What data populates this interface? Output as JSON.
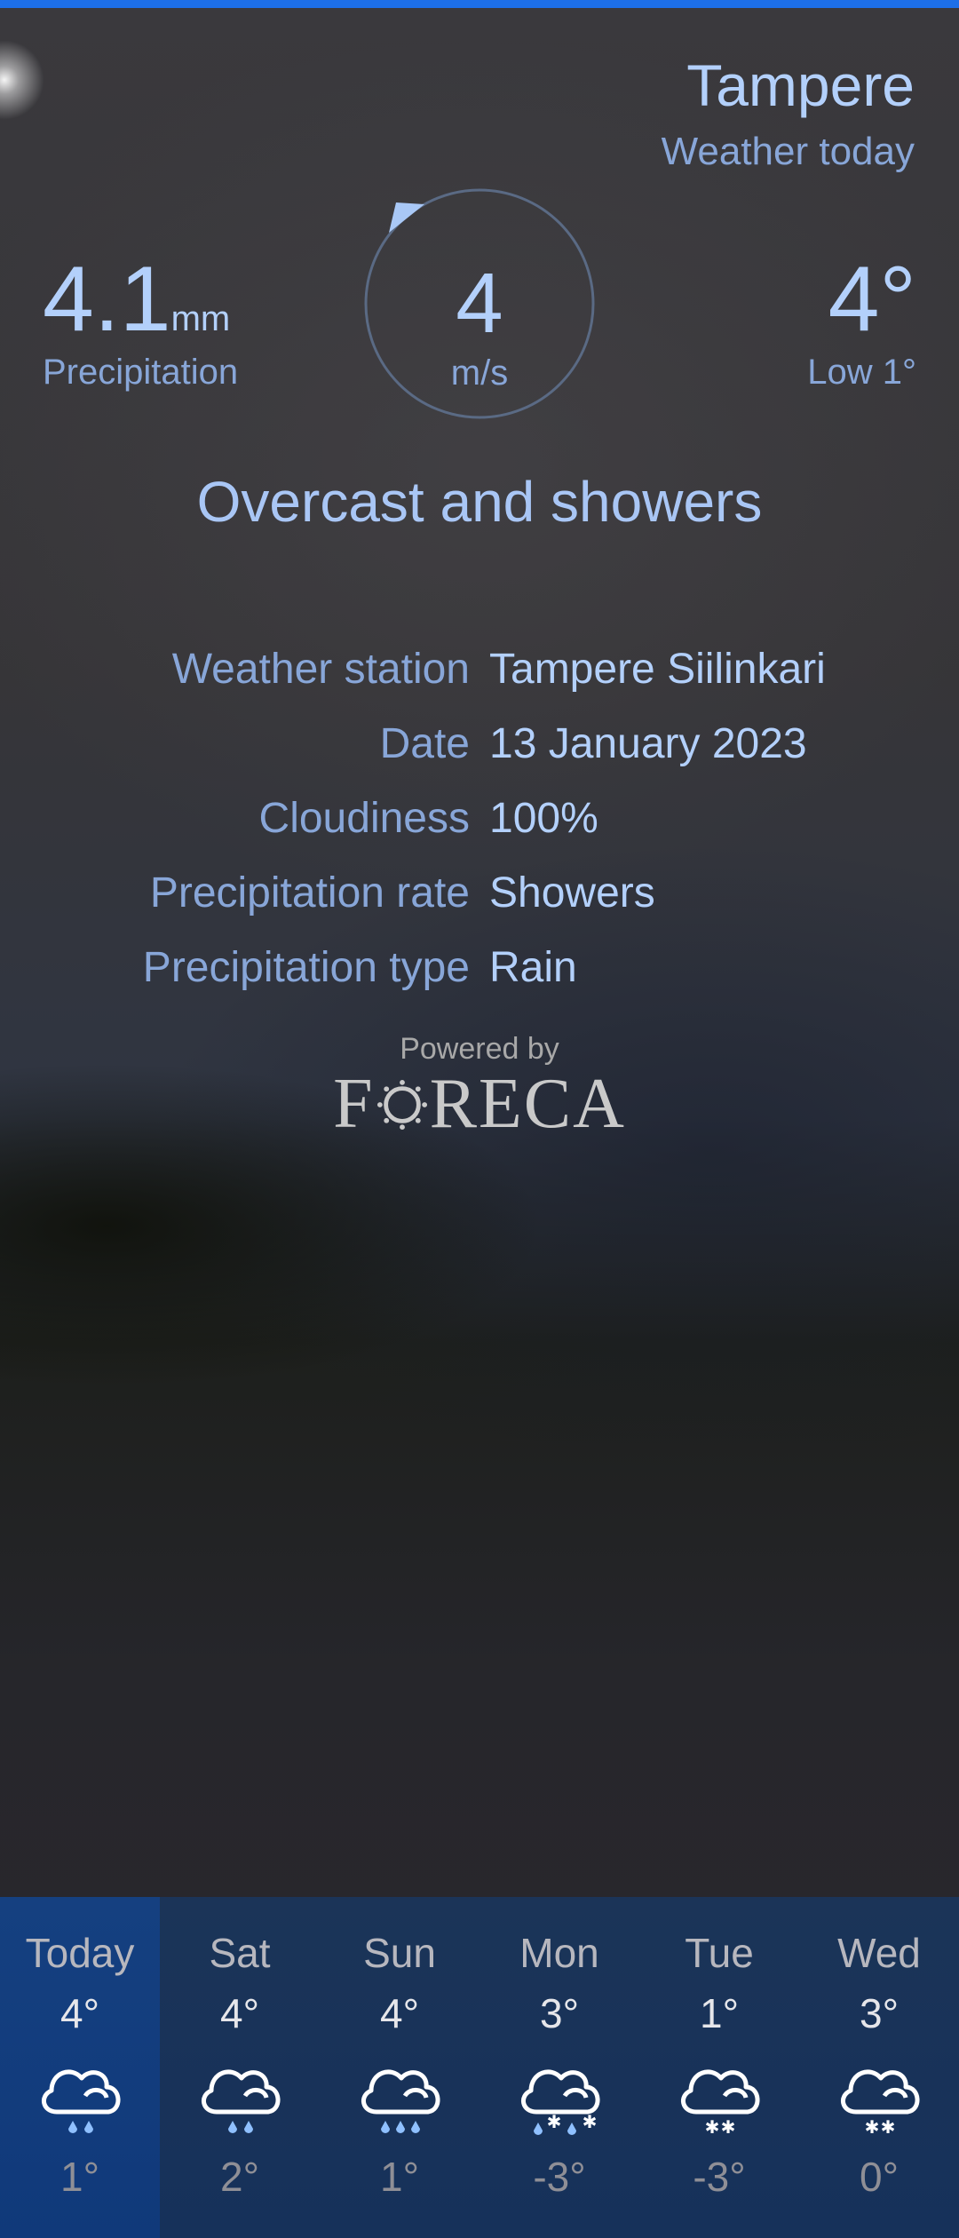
{
  "header": {
    "city": "Tampere",
    "subtitle": "Weather today"
  },
  "precipitation": {
    "value": "4.1",
    "unit": "mm",
    "label": "Precipitation"
  },
  "wind": {
    "value": "4",
    "unit": "m/s"
  },
  "temperature": {
    "value": "4°",
    "low": "Low 1°"
  },
  "description": "Overcast and showers",
  "details": [
    {
      "key": "Weather station",
      "value": "Tampere Siilinkari"
    },
    {
      "key": "Date",
      "value": "13 January 2023"
    },
    {
      "key": "Cloudiness",
      "value": "100%"
    },
    {
      "key": "Precipitation rate",
      "value": "Showers"
    },
    {
      "key": "Precipitation type",
      "value": "Rain"
    }
  ],
  "credit": {
    "powered_by": "Powered by",
    "brand": "FORECA"
  },
  "forecast": [
    {
      "name": "Today",
      "high": "4°",
      "low": "1°",
      "icon": "cloud-rain-icon"
    },
    {
      "name": "Sat",
      "high": "4°",
      "low": "2°",
      "icon": "cloud-rain-icon"
    },
    {
      "name": "Sun",
      "high": "4°",
      "low": "1°",
      "icon": "cloud-heavy-rain-icon"
    },
    {
      "name": "Mon",
      "high": "3°",
      "low": "-3°",
      "icon": "cloud-sleet-icon"
    },
    {
      "name": "Tue",
      "high": "1°",
      "low": "-3°",
      "icon": "cloud-snow-icon"
    },
    {
      "name": "Wed",
      "high": "3°",
      "low": "0°",
      "icon": "cloud-snow-icon"
    }
  ],
  "colors": {
    "accent": "#1d6fe8",
    "primary_text": "#b3d0fb",
    "secondary_text": "#88a6d8",
    "forecast_bg": "#16315a",
    "forecast_selected": "#10397a"
  }
}
